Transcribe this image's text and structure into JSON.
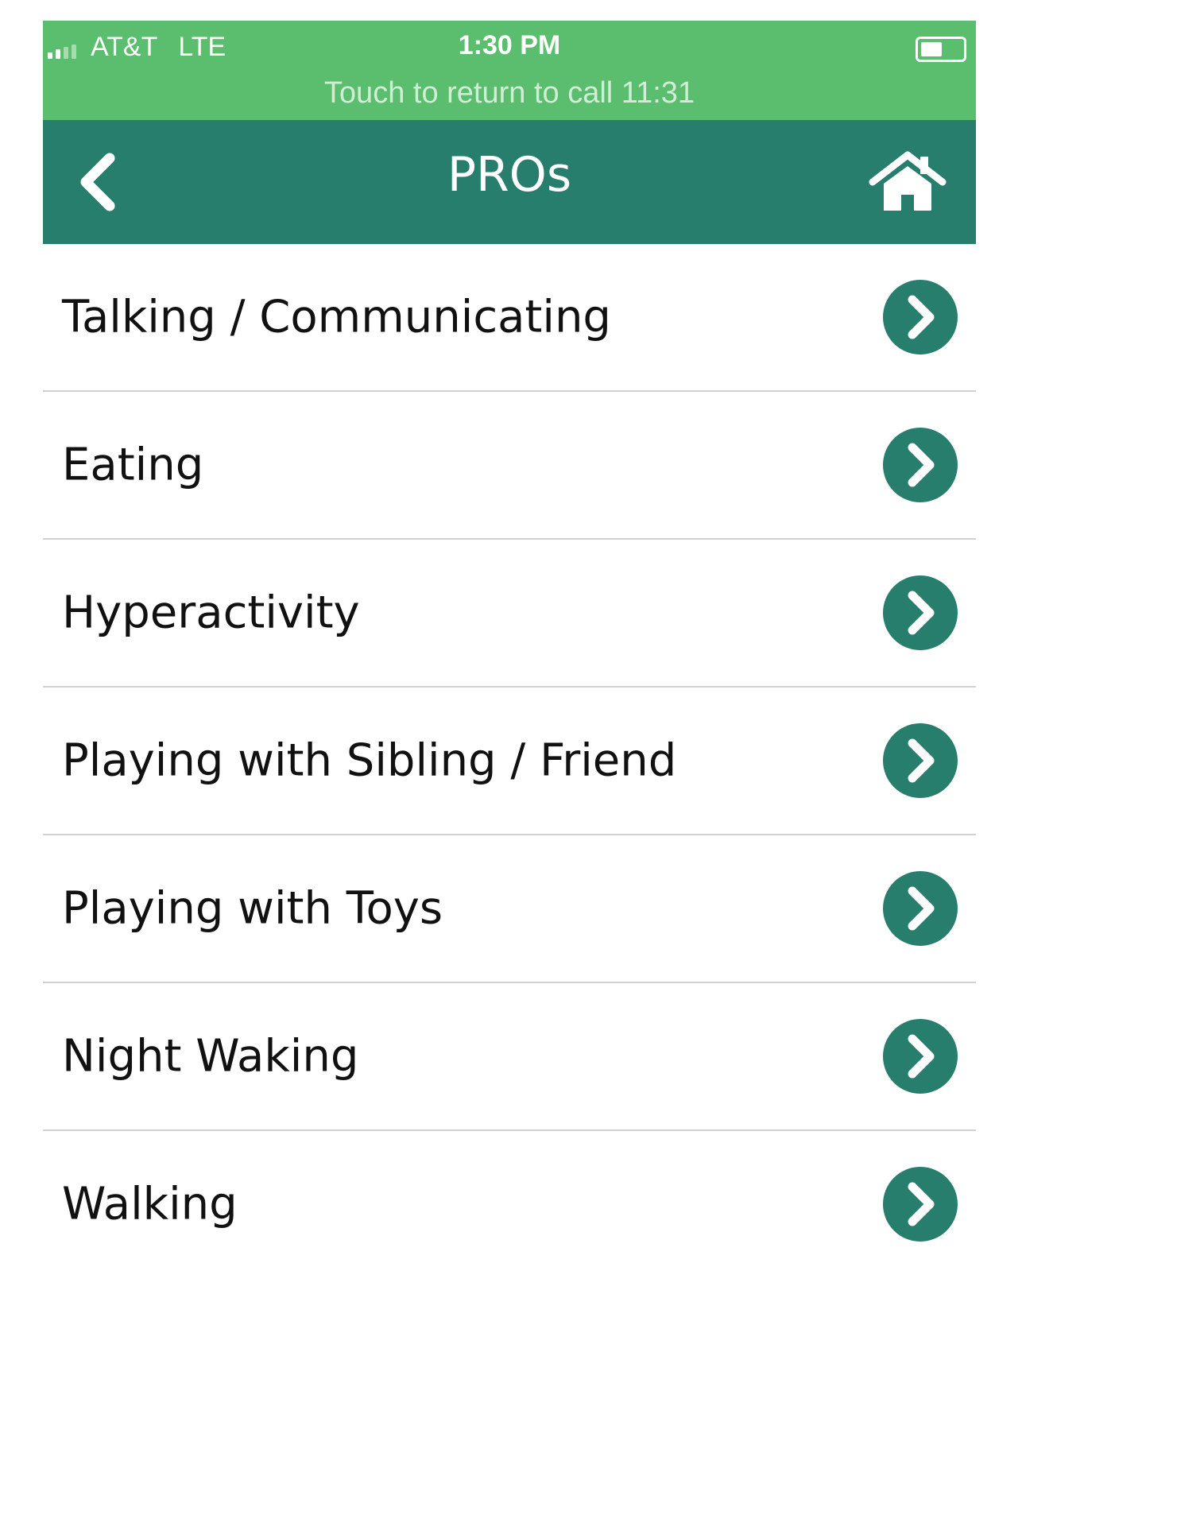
{
  "status_bar": {
    "carrier": "AT&T",
    "network": "LTE",
    "time": "1:30 PM",
    "return_to_call": "Touch to return to call 11:31",
    "icons": [
      "signal-icon",
      "battery-icon"
    ]
  },
  "nav": {
    "title": "PROs",
    "back_icon": "chevron-left-icon",
    "home_icon": "home-icon"
  },
  "colors": {
    "status_bar_bg": "#5bbd6e",
    "nav_bar_bg": "#277e6c",
    "accent": "#277e6c",
    "divider": "#d2d2d2"
  },
  "items": [
    {
      "label": "Talking / Communicating"
    },
    {
      "label": "Eating"
    },
    {
      "label": "Hyperactivity"
    },
    {
      "label": "Playing with Sibling / Friend"
    },
    {
      "label": "Playing with Toys"
    },
    {
      "label": "Night Waking"
    },
    {
      "label": "Walking"
    }
  ],
  "item_icon": "chevron-circle-right-icon"
}
